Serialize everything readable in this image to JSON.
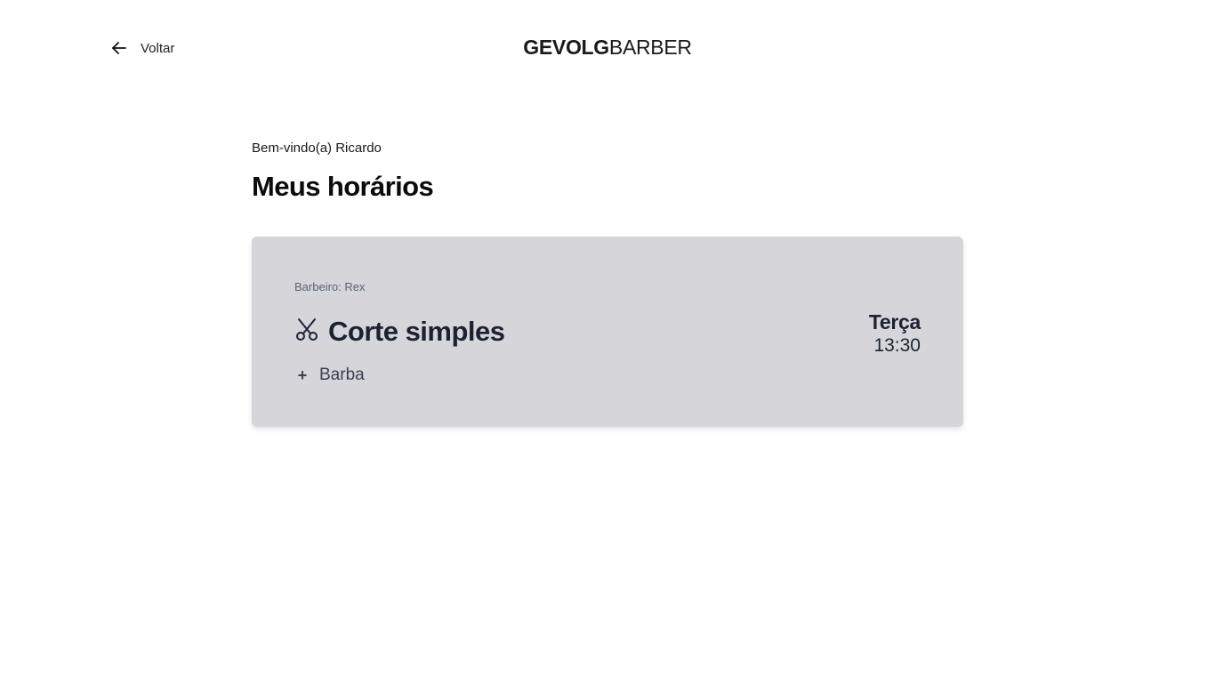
{
  "header": {
    "back_label": "Voltar",
    "logo_bold": "GEVOLG",
    "logo_light": "BARBER",
    "back_icon": "arrow-left-icon"
  },
  "main": {
    "welcome": "Bem-vindo(a) Ricardo",
    "title": "Meus horários"
  },
  "appointments": [
    {
      "barber": "Barbeiro: Rex",
      "service": "Corte simples",
      "service_icon": "scissors-icon",
      "extra": "Barba",
      "day": "Terça",
      "time": "13:30"
    }
  ],
  "colors": {
    "card_bg": "#d6d6da",
    "text_dark": "#1c2232",
    "text_muted": "#5a6272"
  }
}
